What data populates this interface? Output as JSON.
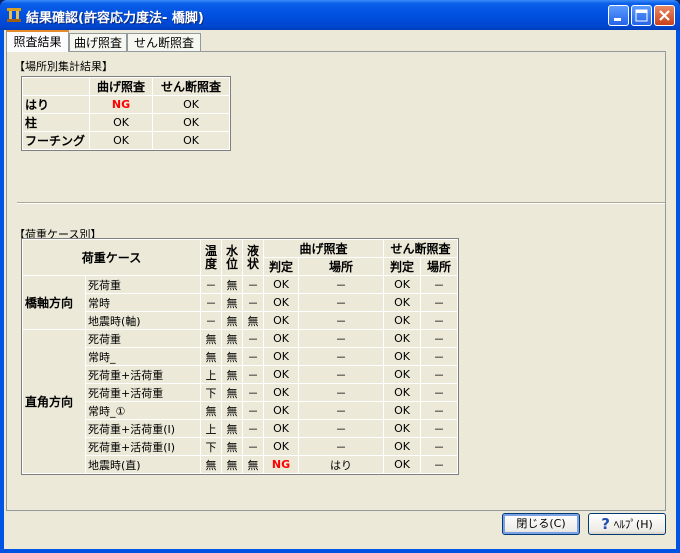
{
  "window": {
    "title": "結果確認(許容応力度法- 橋脚)"
  },
  "tabs": [
    {
      "label": "照査結果"
    },
    {
      "label": "曲げ照査"
    },
    {
      "label": "せん断照査"
    }
  ],
  "summary": {
    "label": "【場所別集計結果】",
    "headers": [
      "曲げ照査",
      "せん断照査"
    ],
    "rows": [
      {
        "place": "はり",
        "bending": "NG",
        "shear": "OK"
      },
      {
        "place": "柱",
        "bending": "OK",
        "shear": "OK"
      },
      {
        "place": "フーチング",
        "bending": "OK",
        "shear": "OK"
      }
    ]
  },
  "loadcases": {
    "label": "【荷重ケース別】",
    "headers": {
      "case": "荷重ケース",
      "temp": "温度",
      "water": "水位",
      "liquefaction": "液状",
      "bending": "曲げ照査",
      "shear": "せん断照査",
      "judge": "判定",
      "place": "場所"
    },
    "groups": [
      {
        "name": "橋軸方向",
        "rows": [
          {
            "case": "死荷重",
            "temp": "－",
            "water": "無",
            "liq": "－",
            "b_judge": "OK",
            "b_place": "－",
            "s_judge": "OK",
            "s_place": "－"
          },
          {
            "case": "常時",
            "temp": "－",
            "water": "無",
            "liq": "－",
            "b_judge": "OK",
            "b_place": "－",
            "s_judge": "OK",
            "s_place": "－"
          },
          {
            "case": "地震時(軸)",
            "temp": "－",
            "water": "無",
            "liq": "無",
            "b_judge": "OK",
            "b_place": "－",
            "s_judge": "OK",
            "s_place": "－"
          }
        ]
      },
      {
        "name": "直角方向",
        "rows": [
          {
            "case": "死荷重",
            "temp": "無",
            "water": "無",
            "liq": "－",
            "b_judge": "OK",
            "b_place": "－",
            "s_judge": "OK",
            "s_place": "－"
          },
          {
            "case": "常時_",
            "temp": "無",
            "water": "無",
            "liq": "－",
            "b_judge": "OK",
            "b_place": "－",
            "s_judge": "OK",
            "s_place": "－"
          },
          {
            "case": "死荷重+活荷重",
            "temp": "上",
            "water": "無",
            "liq": "－",
            "b_judge": "OK",
            "b_place": "－",
            "s_judge": "OK",
            "s_place": "－"
          },
          {
            "case": "死荷重+活荷重",
            "temp": "下",
            "water": "無",
            "liq": "－",
            "b_judge": "OK",
            "b_place": "－",
            "s_judge": "OK",
            "s_place": "－"
          },
          {
            "case": "常時_①",
            "temp": "無",
            "water": "無",
            "liq": "－",
            "b_judge": "OK",
            "b_place": "－",
            "s_judge": "OK",
            "s_place": "－"
          },
          {
            "case": "死荷重+活荷重(I)",
            "temp": "上",
            "water": "無",
            "liq": "－",
            "b_judge": "OK",
            "b_place": "－",
            "s_judge": "OK",
            "s_place": "－"
          },
          {
            "case": "死荷重+活荷重(I)",
            "temp": "下",
            "water": "無",
            "liq": "－",
            "b_judge": "OK",
            "b_place": "－",
            "s_judge": "OK",
            "s_place": "－"
          },
          {
            "case": "地震時(直)",
            "temp": "無",
            "water": "無",
            "liq": "無",
            "b_judge": "NG",
            "b_place": "はり",
            "s_judge": "OK",
            "s_place": "－"
          }
        ]
      }
    ]
  },
  "buttons": {
    "close": "閉じる(C)",
    "help": "ﾍﾙﾌﾟ(H)"
  },
  "colors": {
    "ng": "#ff0000",
    "titlebar": "#0054e3",
    "face": "#ece9d8"
  }
}
